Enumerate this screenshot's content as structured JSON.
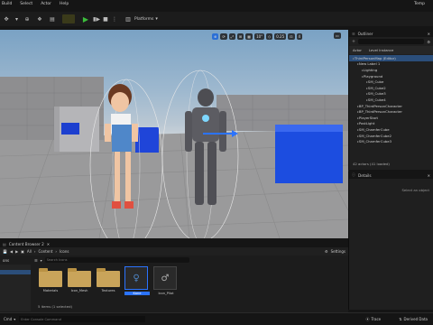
{
  "menu": [
    "Build",
    "Select",
    "Actor",
    "Help"
  ],
  "window": {
    "title_tail": "Temp"
  },
  "toolbar": {
    "platforms": "Platforms"
  },
  "viewport": {
    "chips": [
      "⊕",
      "⟳",
      "⤢",
      "⊞",
      "▦",
      "10°",
      "◇",
      "0.25",
      "⊡",
      "4"
    ],
    "fov": "10°",
    "scale": "0.25",
    "cam": "4"
  },
  "outliner": {
    "title": "Outliner",
    "tabs": [
      "Actor",
      "Level Instance"
    ],
    "items": [
      {
        "label": "ThirdPersonMap (Editor)",
        "indent": 0,
        "selected": true
      },
      {
        "label": "New Label 1",
        "indent": 1
      },
      {
        "label": "Lighting",
        "indent": 2
      },
      {
        "label": "Playground",
        "indent": 2
      },
      {
        "label": "SM_Cube",
        "indent": 3
      },
      {
        "label": "SM_Cube2",
        "indent": 3
      },
      {
        "label": "SM_Cube3",
        "indent": 3
      },
      {
        "label": "SM_Cube4",
        "indent": 3
      },
      {
        "label": "BP_ThirdPersonCharacter",
        "indent": 1
      },
      {
        "label": "BP_ThirdPersonCharacter",
        "indent": 1
      },
      {
        "label": "PlayerStart",
        "indent": 1
      },
      {
        "label": "PostLight",
        "indent": 1
      },
      {
        "label": "SM_ChamferCube",
        "indent": 1
      },
      {
        "label": "SM_ChamferCube2",
        "indent": 1
      },
      {
        "label": "SM_ChamferCube3",
        "indent": 1
      }
    ],
    "count": "42 actors (41 loaded)"
  },
  "details": {
    "title": "Details",
    "hint": "Select an object"
  },
  "content_browser": {
    "tab": "Content Browser 2",
    "breadcrumb": [
      "All",
      "Content",
      "Icons"
    ],
    "settings": "Settings",
    "search_placeholder": "Search Icons",
    "tiles": [
      {
        "label": "Materials",
        "kind": "folder"
      },
      {
        "label": "Icon_Mesh",
        "kind": "folder"
      },
      {
        "label": "Textures",
        "kind": "folder"
      },
      {
        "label": "Kane",
        "kind": "girl"
      },
      {
        "label": "Icon_Pilot",
        "kind": "robot"
      }
    ],
    "footer": "5 items (1 selected)",
    "left_label": "ons"
  },
  "status": {
    "cmd": "Cmd",
    "cmd_placeholder": "Enter Console Command",
    "trace": "Trace",
    "derived": "Derived Data"
  }
}
